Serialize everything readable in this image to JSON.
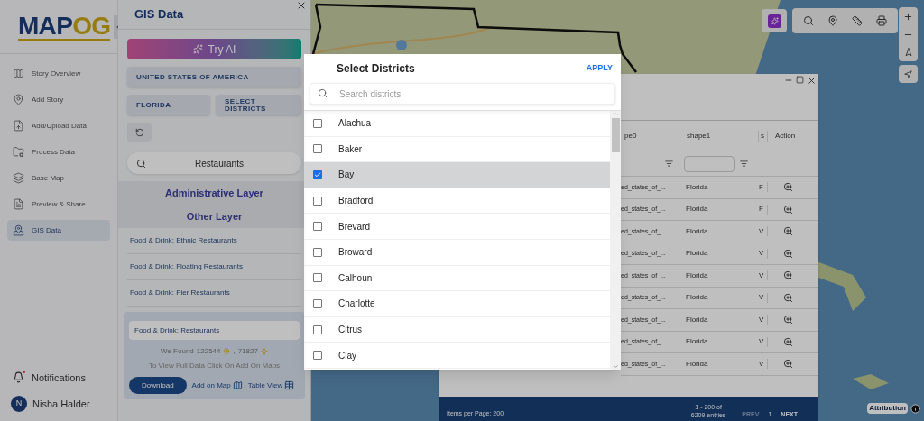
{
  "sidebar": {
    "logo": {
      "left": "MAP",
      "right": "OG"
    },
    "items": [
      {
        "label": "Story Overview",
        "selected": false
      },
      {
        "label": "Add Story",
        "selected": false
      },
      {
        "label": "Add/Upload Data",
        "selected": false
      },
      {
        "label": "Process Data",
        "selected": false
      },
      {
        "label": "Base Map",
        "selected": false
      },
      {
        "label": "Preview & Share",
        "selected": false
      },
      {
        "label": "GIS Data",
        "selected": true
      }
    ],
    "notifications": "Notifications",
    "user": {
      "initial": "N",
      "name": "Nisha Halder"
    }
  },
  "panel": {
    "title": "GIS Data",
    "try_ai": "Try AI",
    "country": "UNITED STATES OF AMERICA",
    "state": "FLORIDA",
    "districts_button": "SELECT DISTRICTS",
    "search": "Restaurants",
    "admin_layer": "Administrative Layer",
    "other_layer": "Other Layer",
    "layers": [
      "Food & Drink: Ethnic Restaurants",
      "Food & Drink: Floating Restaurants",
      "Food & Drink: Pier Restaurants"
    ],
    "result": {
      "name": "Food & Drink: Restaurants",
      "found": "We Found",
      "points": "122544",
      "comma": ",",
      "polygons": "71827",
      "hint": "To View Full Data Click On Add On Maps",
      "download": "Download",
      "add_on_map": "Add on Map",
      "table_view": "Table View"
    }
  },
  "table": {
    "columns": [
      "pe0",
      "shape1",
      "s",
      "Action"
    ],
    "rows": [
      {
        "c0": "ed_states_of_...",
        "c1": "Florida",
        "c2": "F"
      },
      {
        "c0": "ed_states_of_...",
        "c1": "Florida",
        "c2": "F"
      },
      {
        "c0": "ed_states_of_...",
        "c1": "Florida",
        "c2": "V"
      },
      {
        "c0": "ed_states_of_...",
        "c1": "Florida",
        "c2": "V"
      },
      {
        "c0": "ed_states_of_...",
        "c1": "Florida",
        "c2": "V"
      },
      {
        "c0": "ed_states_of_...",
        "c1": "Florida",
        "c2": "V"
      },
      {
        "c0": "ed_states_of_...",
        "c1": "Florida",
        "c2": "V"
      },
      {
        "c0": "ed_states_of_...",
        "c1": "Florida",
        "c2": "V"
      },
      {
        "c0": "ed_states_of_...",
        "c1": "Florida",
        "c2": "V"
      }
    ],
    "footer": {
      "per_page": "Items per Page: 200",
      "range": "1 - 200 of",
      "total": "6209 entries",
      "prev": "PREV",
      "page": "1",
      "next": "NEXT"
    }
  },
  "map": {
    "attribution": "Attribution"
  },
  "dialog": {
    "title": "Select Districts",
    "apply": "APPLY",
    "placeholder": "Search districts",
    "districts": [
      {
        "name": "Alachua",
        "checked": false
      },
      {
        "name": "Baker",
        "checked": false
      },
      {
        "name": "Bay",
        "checked": true
      },
      {
        "name": "Bradford",
        "checked": false
      },
      {
        "name": "Brevard",
        "checked": false
      },
      {
        "name": "Broward",
        "checked": false
      },
      {
        "name": "Calhoun",
        "checked": false
      },
      {
        "name": "Charlotte",
        "checked": false
      },
      {
        "name": "Citrus",
        "checked": false
      },
      {
        "name": "Clay",
        "checked": false
      }
    ]
  }
}
